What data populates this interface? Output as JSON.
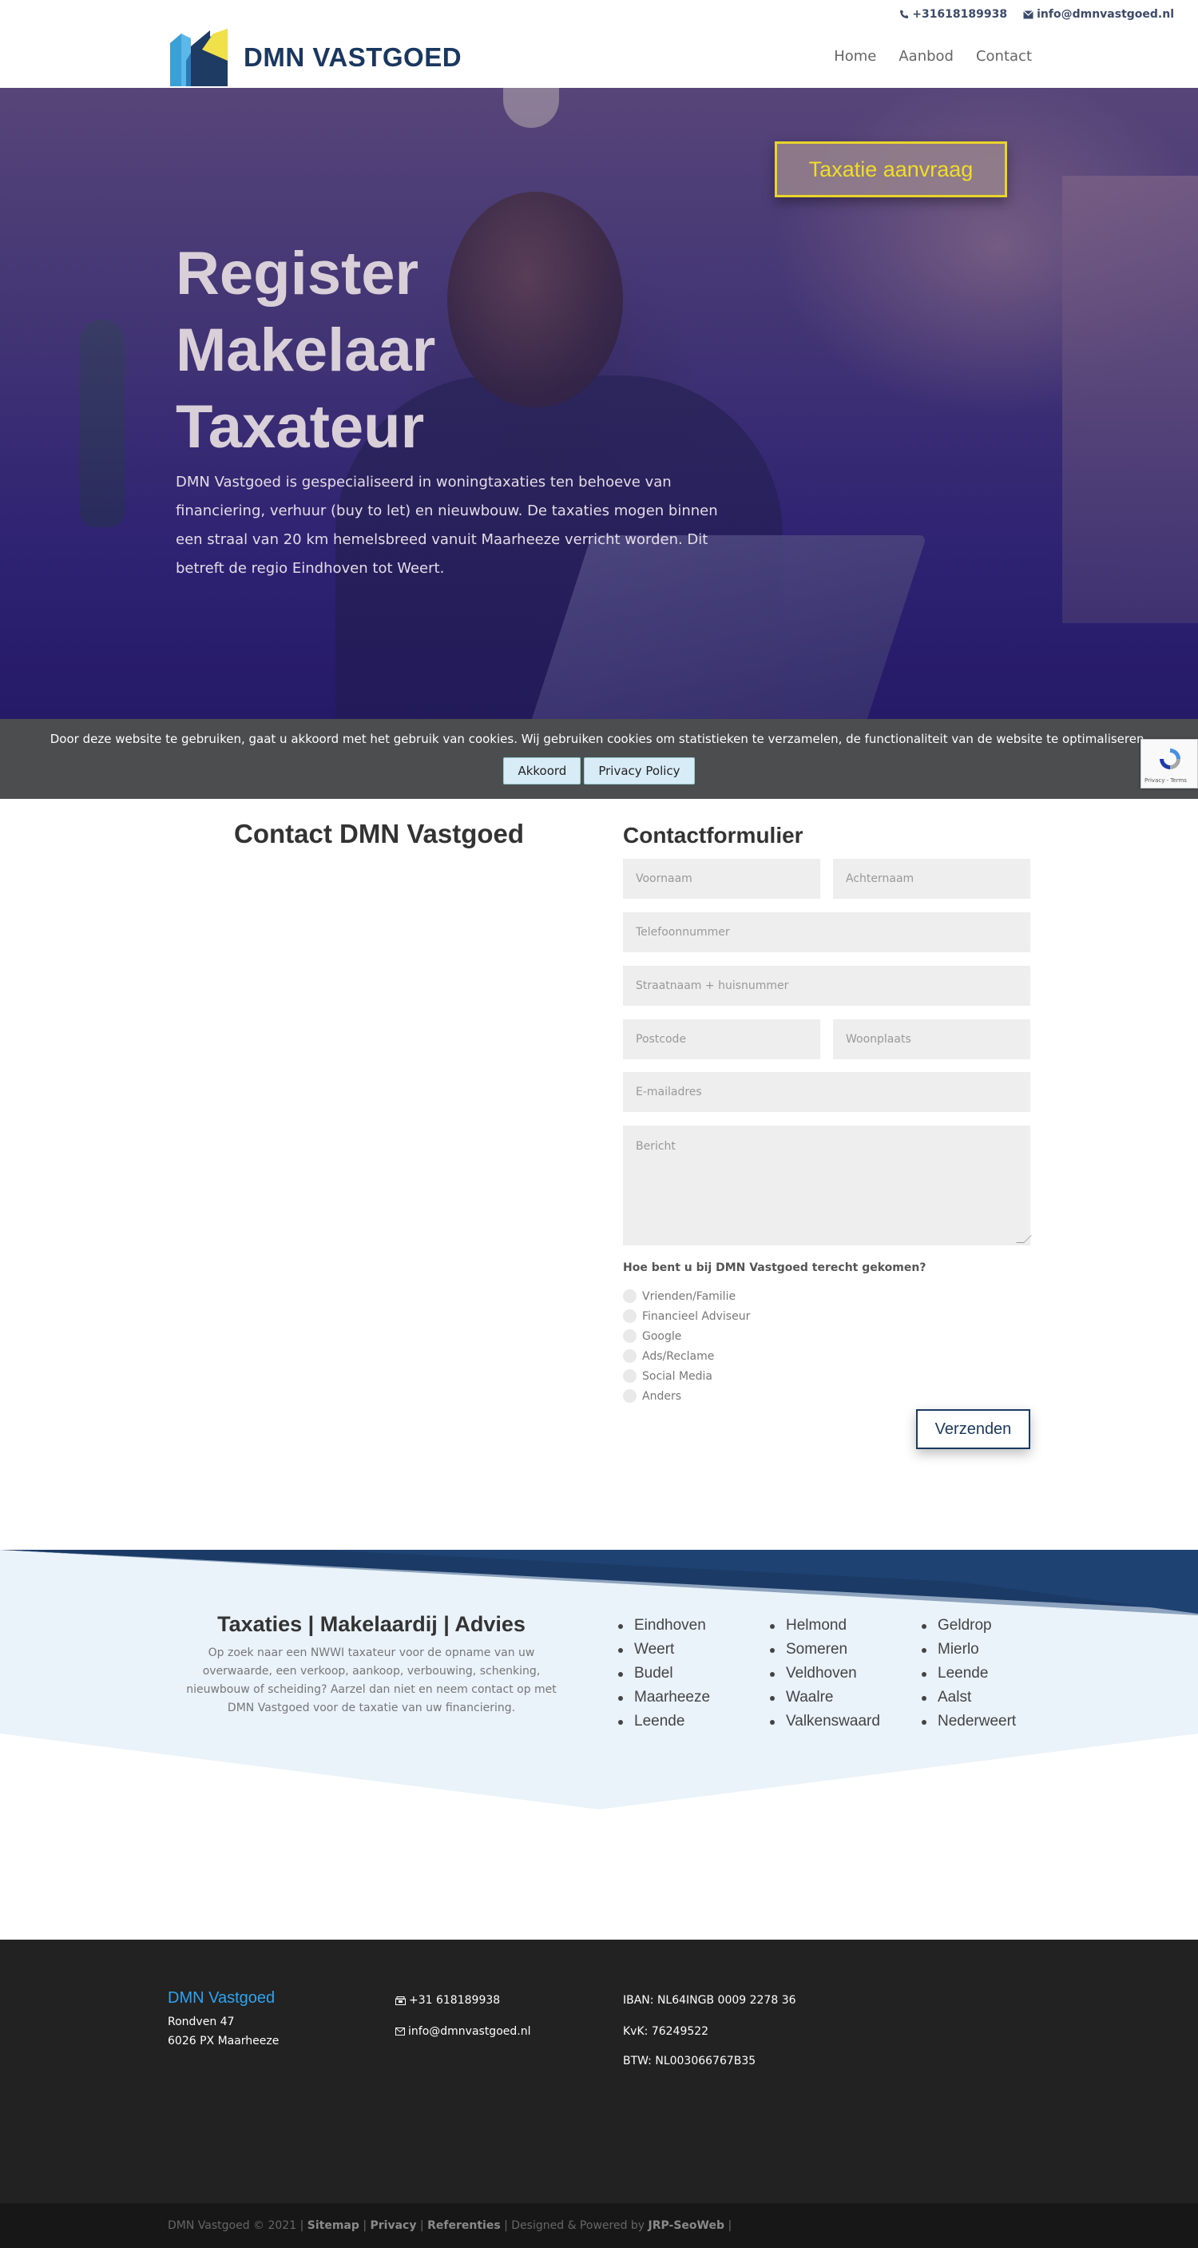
{
  "topbar": {
    "phone": "+31618189938",
    "email": "info@dmnvastgoed.nl"
  },
  "header": {
    "logo_text": "DMN VASTGOED",
    "nav": [
      "Home",
      "Aanbod",
      "Contact"
    ]
  },
  "hero": {
    "title_lines": [
      "Register",
      "Makelaar",
      "Taxateur"
    ],
    "text": "DMN Vastgoed is gespecialiseerd in woningtaxaties ten behoeve van financiering, verhuur (buy to let) en nieuwbouw. De taxaties mogen binnen een straal van 20 km hemelsbreed vanuit Maarheeze verricht worden. Dit betreft de regio Eindhoven tot Weert.",
    "cta_label": "Taxatie aanvraag"
  },
  "cookie": {
    "text": "Door deze website te gebruiken, gaat u akkoord met het gebruik van cookies. Wij gebruiken cookies om statistieken te verzamelen, de functionaliteit van de website te optimaliseren.",
    "accept_label": "Akkoord",
    "privacy_label": "Privacy Policy"
  },
  "recaptcha": {
    "label": "Privacy - Terms"
  },
  "contact": {
    "title": "Contact DMN Vastgoed",
    "form_title": "Contactformulier",
    "placeholders": {
      "first_name": "Voornaam",
      "last_name": "Achternaam",
      "phone": "Telefoonnummer",
      "street": "Straatnaam + huisnummer",
      "postcode": "Postcode",
      "city": "Woonplaats",
      "email": "E-mailadres",
      "message": "Bericht"
    },
    "question": "Hoe bent u bij DMN Vastgoed terecht gekomen?",
    "options": [
      "Vrienden/Familie",
      "Financieel Adviseur",
      "Google",
      "Ads/Reclame",
      "Social Media",
      "Anders"
    ],
    "submit_label": "Verzenden"
  },
  "areas": {
    "title": "Taxaties | Makelaardij | Advies",
    "text": "Op zoek naar een NWWI taxateur voor de opname van uw overwaarde, een verkoop, aankoop, verbouwing, schenking, nieuwbouw of scheiding? Aarzel dan niet en neem contact op met DMN Vastgoed voor de taxatie van uw financiering.",
    "col1": [
      "Eindhoven",
      "Weert",
      "Budel",
      "Maarheeze",
      "Leende"
    ],
    "col2": [
      "Helmond",
      "Someren",
      "Veldhoven",
      "Waalre",
      "Valkenswaard"
    ],
    "col3": [
      "Geldrop",
      "Mierlo",
      "Leende",
      "Aalst",
      "Nederweert"
    ]
  },
  "footer": {
    "brand": "DMN Vastgoed",
    "address1": "Rondven 47",
    "address2": "6026 PX  Maarheeze",
    "phone": "+31 618189938",
    "email": "info@dmnvastgoed.nl",
    "iban": "IBAN: NL64INGB 0009 2278 36",
    "kvk": "KvK: 76249522",
    "btw": "BTW: NL003066767B35",
    "copyright": "DMN Vastgoed © 2021 |",
    "sitemap": "Sitemap",
    "privacy": "Privacy",
    "referenties": "Referenties",
    "designed": "| Designed & Powered by",
    "designer": "JRP-SeoWeb",
    "sep": "|"
  },
  "colors": {
    "brand_navy": "#1a3760",
    "accent_yellow": "#e8d42a",
    "link_blue": "#2ea3f2",
    "footer_bg": "#222222"
  }
}
